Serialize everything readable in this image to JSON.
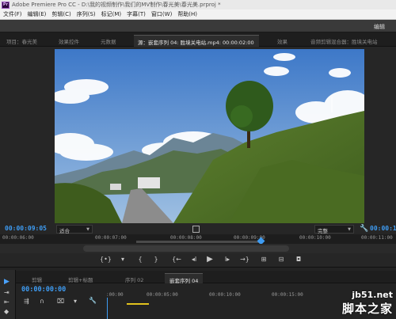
{
  "app": {
    "logo_text": "Pr",
    "title": "Adobe Premiere Pro CC - D:\\我的视频制作\\我们的MV制作\\春光美\\春光美.prproj *"
  },
  "menu": [
    "文件(F)",
    "编辑(E)",
    "剪辑(C)",
    "序列(S)",
    "标记(M)",
    "字幕(T)",
    "窗口(W)",
    "帮助(H)"
  ],
  "workspace": {
    "label": "编辑"
  },
  "panel_tabs": {
    "project": "项目：春光美",
    "effect_controls": "效果控件",
    "metadata": "元数据",
    "source": "源：嵌套序列 04: 胜境关电站.mp4: 00:00:02:00",
    "effects": "效果",
    "audio_mixer": "音频剪辑混合器：胜境关电站"
  },
  "monitor": {
    "current_timecode": "00:00:09:05",
    "zoom": "适合",
    "quality": "完整",
    "duration_timecode": "00:00:10:00",
    "ruler": [
      "00:00:06:00",
      "00:00:07:00",
      "00:00:08:00",
      "00:00:09:00",
      "00:00:10:00",
      "00:00:11:00"
    ]
  },
  "transport": {
    "buttons": [
      "mark-in",
      "add-marker",
      "mark-in-bracket",
      "mark-out-bracket",
      "go-to-in",
      "step-back",
      "play",
      "step-forward",
      "go-to-out",
      "insert",
      "overwrite",
      "export-frame"
    ]
  },
  "timeline": {
    "tabs": [
      "剪辑",
      "剪辑+标题",
      "序列 02",
      "嵌套序列 04"
    ],
    "active_tab": "嵌套序列 04",
    "timecode": "00:00:00:00",
    "ruler": [
      ":00:00",
      "00:00:05:00",
      "00:00:10:00",
      "00:00:15:00"
    ]
  },
  "watermark": {
    "site": "jb51.net",
    "name": "脚本之家"
  }
}
